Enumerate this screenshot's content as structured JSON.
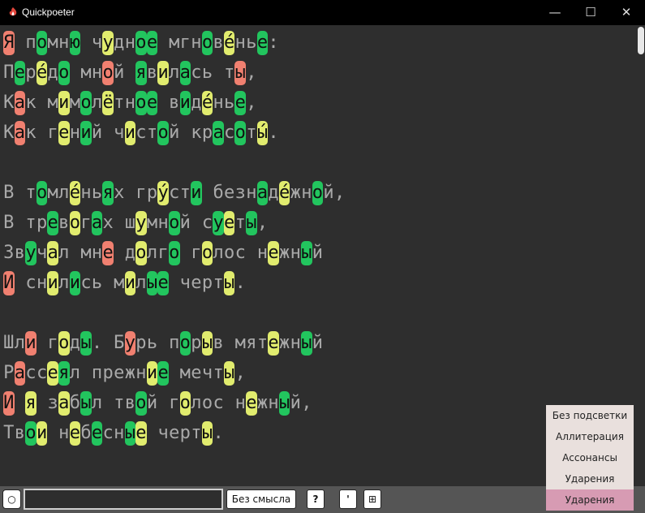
{
  "window": {
    "title": "Quickpoeter",
    "minimize": "—",
    "maximize": "☐",
    "close": "✕"
  },
  "editor": {
    "lines": [
      [
        [
          "Я",
          "r"
        ],
        [
          " ",
          ""
        ],
        [
          "п",
          ""
        ],
        [
          "о",
          "g"
        ],
        [
          "м",
          ""
        ],
        [
          "н",
          ""
        ],
        [
          "ю",
          "g"
        ],
        [
          " ",
          ""
        ],
        [
          "ч",
          ""
        ],
        [
          "у",
          "y"
        ],
        [
          "д",
          ""
        ],
        [
          "н",
          ""
        ],
        [
          "о",
          "g"
        ],
        [
          "е",
          "g"
        ],
        [
          " ",
          ""
        ],
        [
          "м",
          ""
        ],
        [
          "г",
          ""
        ],
        [
          "н",
          ""
        ],
        [
          "о",
          "g"
        ],
        [
          "в",
          ""
        ],
        [
          "е́",
          "y"
        ],
        [
          "н",
          ""
        ],
        [
          "ь",
          ""
        ],
        [
          "е",
          "g"
        ],
        [
          ":",
          ""
        ]
      ],
      [
        [
          "П",
          ""
        ],
        [
          "е",
          "g"
        ],
        [
          "р",
          ""
        ],
        [
          "е́",
          "y"
        ],
        [
          "д",
          ""
        ],
        [
          "о",
          "g"
        ],
        [
          " ",
          ""
        ],
        [
          "м",
          ""
        ],
        [
          "н",
          ""
        ],
        [
          "о",
          "r"
        ],
        [
          "й",
          ""
        ],
        [
          " ",
          ""
        ],
        [
          "я",
          "g"
        ],
        [
          "в",
          ""
        ],
        [
          "и",
          "y"
        ],
        [
          "л",
          ""
        ],
        [
          "а",
          "g"
        ],
        [
          "с",
          ""
        ],
        [
          "ь",
          ""
        ],
        [
          " ",
          ""
        ],
        [
          "т",
          ""
        ],
        [
          "ы",
          "r"
        ],
        [
          ",",
          ""
        ]
      ],
      [
        [
          "К",
          ""
        ],
        [
          "а",
          "r"
        ],
        [
          "к",
          ""
        ],
        [
          " ",
          ""
        ],
        [
          "м",
          ""
        ],
        [
          "и",
          "y"
        ],
        [
          "м",
          ""
        ],
        [
          "о",
          "g"
        ],
        [
          "л",
          ""
        ],
        [
          "ё",
          "y"
        ],
        [
          "т",
          ""
        ],
        [
          "н",
          ""
        ],
        [
          "о",
          "g"
        ],
        [
          "е",
          "g"
        ],
        [
          " ",
          ""
        ],
        [
          "в",
          ""
        ],
        [
          "и",
          "g"
        ],
        [
          "д",
          ""
        ],
        [
          "е́",
          "y"
        ],
        [
          "н",
          ""
        ],
        [
          "ь",
          ""
        ],
        [
          "е",
          "g"
        ],
        [
          ",",
          ""
        ]
      ],
      [
        [
          "К",
          ""
        ],
        [
          "а",
          "r"
        ],
        [
          "к",
          ""
        ],
        [
          " ",
          ""
        ],
        [
          "г",
          ""
        ],
        [
          "е",
          "y"
        ],
        [
          "н",
          ""
        ],
        [
          "и",
          "g"
        ],
        [
          "й",
          ""
        ],
        [
          " ",
          ""
        ],
        [
          "ч",
          ""
        ],
        [
          "и",
          "y"
        ],
        [
          "с",
          ""
        ],
        [
          "т",
          ""
        ],
        [
          "о",
          "g"
        ],
        [
          "й",
          ""
        ],
        [
          " ",
          ""
        ],
        [
          "к",
          ""
        ],
        [
          "р",
          ""
        ],
        [
          "а",
          "g"
        ],
        [
          "с",
          ""
        ],
        [
          "о",
          "g"
        ],
        [
          "т",
          ""
        ],
        [
          "ы́",
          "y"
        ],
        [
          ".",
          ""
        ]
      ],
      [],
      [
        [
          "В",
          ""
        ],
        [
          " ",
          ""
        ],
        [
          "т",
          ""
        ],
        [
          "о",
          "g"
        ],
        [
          "м",
          ""
        ],
        [
          "л",
          ""
        ],
        [
          "е́",
          "y"
        ],
        [
          "н",
          ""
        ],
        [
          "ь",
          ""
        ],
        [
          "я",
          "g"
        ],
        [
          "х",
          ""
        ],
        [
          " ",
          ""
        ],
        [
          "г",
          ""
        ],
        [
          "р",
          ""
        ],
        [
          "у́",
          "y"
        ],
        [
          "с",
          ""
        ],
        [
          "т",
          ""
        ],
        [
          "и",
          "g"
        ],
        [
          " ",
          ""
        ],
        [
          "б",
          ""
        ],
        [
          "е",
          ""
        ],
        [
          "з",
          ""
        ],
        [
          "н",
          ""
        ],
        [
          "а",
          "g"
        ],
        [
          "д",
          ""
        ],
        [
          "е́",
          "y"
        ],
        [
          "ж",
          ""
        ],
        [
          "н",
          ""
        ],
        [
          "о",
          "g"
        ],
        [
          "й",
          ""
        ],
        [
          ",",
          ""
        ]
      ],
      [
        [
          "В",
          ""
        ],
        [
          " ",
          ""
        ],
        [
          "т",
          ""
        ],
        [
          "р",
          ""
        ],
        [
          "е",
          "g"
        ],
        [
          "в",
          ""
        ],
        [
          "о",
          "y"
        ],
        [
          "г",
          ""
        ],
        [
          "а",
          "g"
        ],
        [
          "х",
          ""
        ],
        [
          " ",
          ""
        ],
        [
          "ш",
          ""
        ],
        [
          "у",
          "y"
        ],
        [
          "м",
          ""
        ],
        [
          "н",
          ""
        ],
        [
          "о",
          "g"
        ],
        [
          "й",
          ""
        ],
        [
          " ",
          ""
        ],
        [
          "с",
          ""
        ],
        [
          "у",
          "g"
        ],
        [
          "е",
          "y"
        ],
        [
          "т",
          ""
        ],
        [
          "ы",
          "g"
        ],
        [
          ",",
          ""
        ]
      ],
      [
        [
          "З",
          ""
        ],
        [
          "в",
          ""
        ],
        [
          "у",
          "g"
        ],
        [
          "ч",
          ""
        ],
        [
          "а",
          "y"
        ],
        [
          "л",
          ""
        ],
        [
          " ",
          ""
        ],
        [
          "м",
          ""
        ],
        [
          "н",
          ""
        ],
        [
          "е",
          "r"
        ],
        [
          " ",
          ""
        ],
        [
          "д",
          ""
        ],
        [
          "о",
          "y"
        ],
        [
          "л",
          ""
        ],
        [
          "г",
          ""
        ],
        [
          "о",
          "g"
        ],
        [
          " ",
          ""
        ],
        [
          "г",
          ""
        ],
        [
          "о",
          "y"
        ],
        [
          "л",
          ""
        ],
        [
          "о",
          ""
        ],
        [
          "с",
          ""
        ],
        [
          " ",
          ""
        ],
        [
          "н",
          ""
        ],
        [
          "е",
          "y"
        ],
        [
          "ж",
          ""
        ],
        [
          "н",
          ""
        ],
        [
          "ы",
          "g"
        ],
        [
          "й",
          ""
        ]
      ],
      [
        [
          "И",
          "r"
        ],
        [
          " ",
          ""
        ],
        [
          "с",
          ""
        ],
        [
          "н",
          ""
        ],
        [
          "и",
          "y"
        ],
        [
          "л",
          ""
        ],
        [
          "и",
          "g"
        ],
        [
          "с",
          ""
        ],
        [
          "ь",
          ""
        ],
        [
          " ",
          ""
        ],
        [
          "м",
          ""
        ],
        [
          "и",
          "y"
        ],
        [
          "л",
          ""
        ],
        [
          "ы",
          "g"
        ],
        [
          "е",
          "g"
        ],
        [
          " ",
          ""
        ],
        [
          "ч",
          ""
        ],
        [
          "е",
          ""
        ],
        [
          "р",
          ""
        ],
        [
          "т",
          ""
        ],
        [
          "ы",
          "y"
        ],
        [
          ".",
          ""
        ]
      ],
      [],
      [
        [
          "Ш",
          ""
        ],
        [
          "л",
          ""
        ],
        [
          "и",
          "r"
        ],
        [
          " ",
          ""
        ],
        [
          "г",
          ""
        ],
        [
          "о",
          "y"
        ],
        [
          "д",
          ""
        ],
        [
          "ы",
          "g"
        ],
        [
          ".",
          ""
        ],
        [
          " ",
          ""
        ],
        [
          "Б",
          ""
        ],
        [
          "у",
          "r"
        ],
        [
          "р",
          ""
        ],
        [
          "ь",
          ""
        ],
        [
          " ",
          ""
        ],
        [
          "п",
          ""
        ],
        [
          "о",
          "g"
        ],
        [
          "р",
          ""
        ],
        [
          "ы",
          "y"
        ],
        [
          "в",
          ""
        ],
        [
          " ",
          ""
        ],
        [
          "м",
          ""
        ],
        [
          "я",
          ""
        ],
        [
          "т",
          ""
        ],
        [
          "е",
          "y"
        ],
        [
          "ж",
          ""
        ],
        [
          "н",
          ""
        ],
        [
          "ы",
          "g"
        ],
        [
          "й",
          ""
        ]
      ],
      [
        [
          "Р",
          ""
        ],
        [
          "а",
          "r"
        ],
        [
          "с",
          ""
        ],
        [
          "с",
          ""
        ],
        [
          "е",
          "y"
        ],
        [
          "я",
          "g"
        ],
        [
          "л",
          ""
        ],
        [
          " ",
          ""
        ],
        [
          "п",
          ""
        ],
        [
          "р",
          ""
        ],
        [
          "е",
          ""
        ],
        [
          "ж",
          ""
        ],
        [
          "н",
          ""
        ],
        [
          "и",
          "y"
        ],
        [
          "е",
          "g"
        ],
        [
          " ",
          ""
        ],
        [
          "м",
          ""
        ],
        [
          "е",
          ""
        ],
        [
          "ч",
          ""
        ],
        [
          "т",
          ""
        ],
        [
          "ы",
          "y"
        ],
        [
          ",",
          ""
        ]
      ],
      [
        [
          "И",
          "r"
        ],
        [
          " ",
          ""
        ],
        [
          "я",
          "y"
        ],
        [
          " ",
          ""
        ],
        [
          "з",
          ""
        ],
        [
          "а",
          "y"
        ],
        [
          "б",
          ""
        ],
        [
          "ы",
          "g"
        ],
        [
          "л",
          ""
        ],
        [
          " ",
          ""
        ],
        [
          "т",
          ""
        ],
        [
          "в",
          ""
        ],
        [
          "о",
          "g"
        ],
        [
          "й",
          ""
        ],
        [
          " ",
          ""
        ],
        [
          "г",
          ""
        ],
        [
          "о",
          "y"
        ],
        [
          "л",
          ""
        ],
        [
          "о",
          ""
        ],
        [
          "с",
          ""
        ],
        [
          " ",
          ""
        ],
        [
          "н",
          ""
        ],
        [
          "е",
          "y"
        ],
        [
          "ж",
          ""
        ],
        [
          "н",
          ""
        ],
        [
          "ы",
          "g"
        ],
        [
          "й",
          ""
        ],
        [
          ",",
          ""
        ]
      ],
      [
        [
          "Т",
          ""
        ],
        [
          "в",
          ""
        ],
        [
          "о",
          "g"
        ],
        [
          "и",
          "y"
        ],
        [
          " ",
          ""
        ],
        [
          "н",
          ""
        ],
        [
          "е",
          "y"
        ],
        [
          "б",
          ""
        ],
        [
          "е",
          "g"
        ],
        [
          "с",
          ""
        ],
        [
          "н",
          ""
        ],
        [
          "ы",
          "g"
        ],
        [
          "е",
          "y"
        ],
        [
          " ",
          ""
        ],
        [
          "ч",
          ""
        ],
        [
          "е",
          ""
        ],
        [
          "р",
          ""
        ],
        [
          "т",
          ""
        ],
        [
          "ы",
          "y"
        ],
        [
          ".",
          ""
        ]
      ]
    ]
  },
  "toolbar": {
    "mode_label": "Без смысла",
    "question_label": "?",
    "apostrophe_label": "'",
    "grid_label": "⊞",
    "circle_label": "○",
    "input_value": ""
  },
  "menu": {
    "items": [
      "Без подсветки",
      "Аллитерация",
      "Ассонансы",
      "Ударения",
      "Ударения"
    ],
    "selected_index": 4
  },
  "colors": {
    "green": "#22c55e",
    "yellow": "#e1ec6e",
    "red": "#f08070",
    "editor_bg": "#2e2e2e"
  }
}
